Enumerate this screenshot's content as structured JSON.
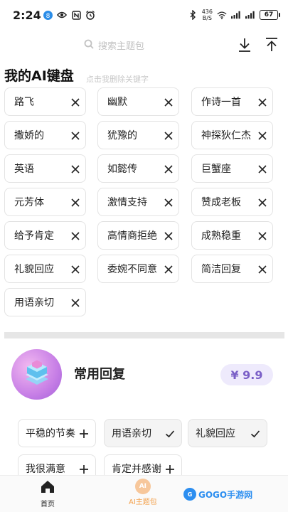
{
  "status_bar": {
    "time": "2:24",
    "notification_count": "8",
    "net_speed_value": "436",
    "net_speed_unit": "B/S",
    "battery": "67"
  },
  "search": {
    "placeholder": "搜索主题包"
  },
  "keyboard_section": {
    "title": "我的AI键盘",
    "hint": "点击我删除关键字",
    "keywords": [
      "路飞",
      "幽默",
      "作诗一首",
      "撒娇的",
      "犹豫的",
      "神探狄仁杰",
      "英语",
      "如懿传",
      "巨蟹座",
      "元芳体",
      "激情支持",
      "赞成老板",
      "给予肯定",
      "高情商拒绝",
      "成熟稳重",
      "礼貌回应",
      "委婉不同意",
      "简洁回复",
      "用语亲切"
    ]
  },
  "pack": {
    "name": "常用回复",
    "price": "¥ 9.9",
    "chips": [
      {
        "label": "平稳的节奏",
        "state": "add"
      },
      {
        "label": "用语亲切",
        "state": "added"
      },
      {
        "label": "礼貌回应",
        "state": "added"
      },
      {
        "label": "我很满意",
        "state": "add"
      },
      {
        "label": "肯定并感谢",
        "state": "add"
      }
    ]
  },
  "bottom_nav": {
    "home_label": "首页",
    "ai_pack_label": "AI主题包",
    "ai_badge": "AI"
  },
  "watermark": {
    "text": "GOGO手游网"
  },
  "colors": {
    "accent_orange": "#f3a24e",
    "price_purple": "#7a5fc7",
    "divider": "#e6e6e6"
  }
}
